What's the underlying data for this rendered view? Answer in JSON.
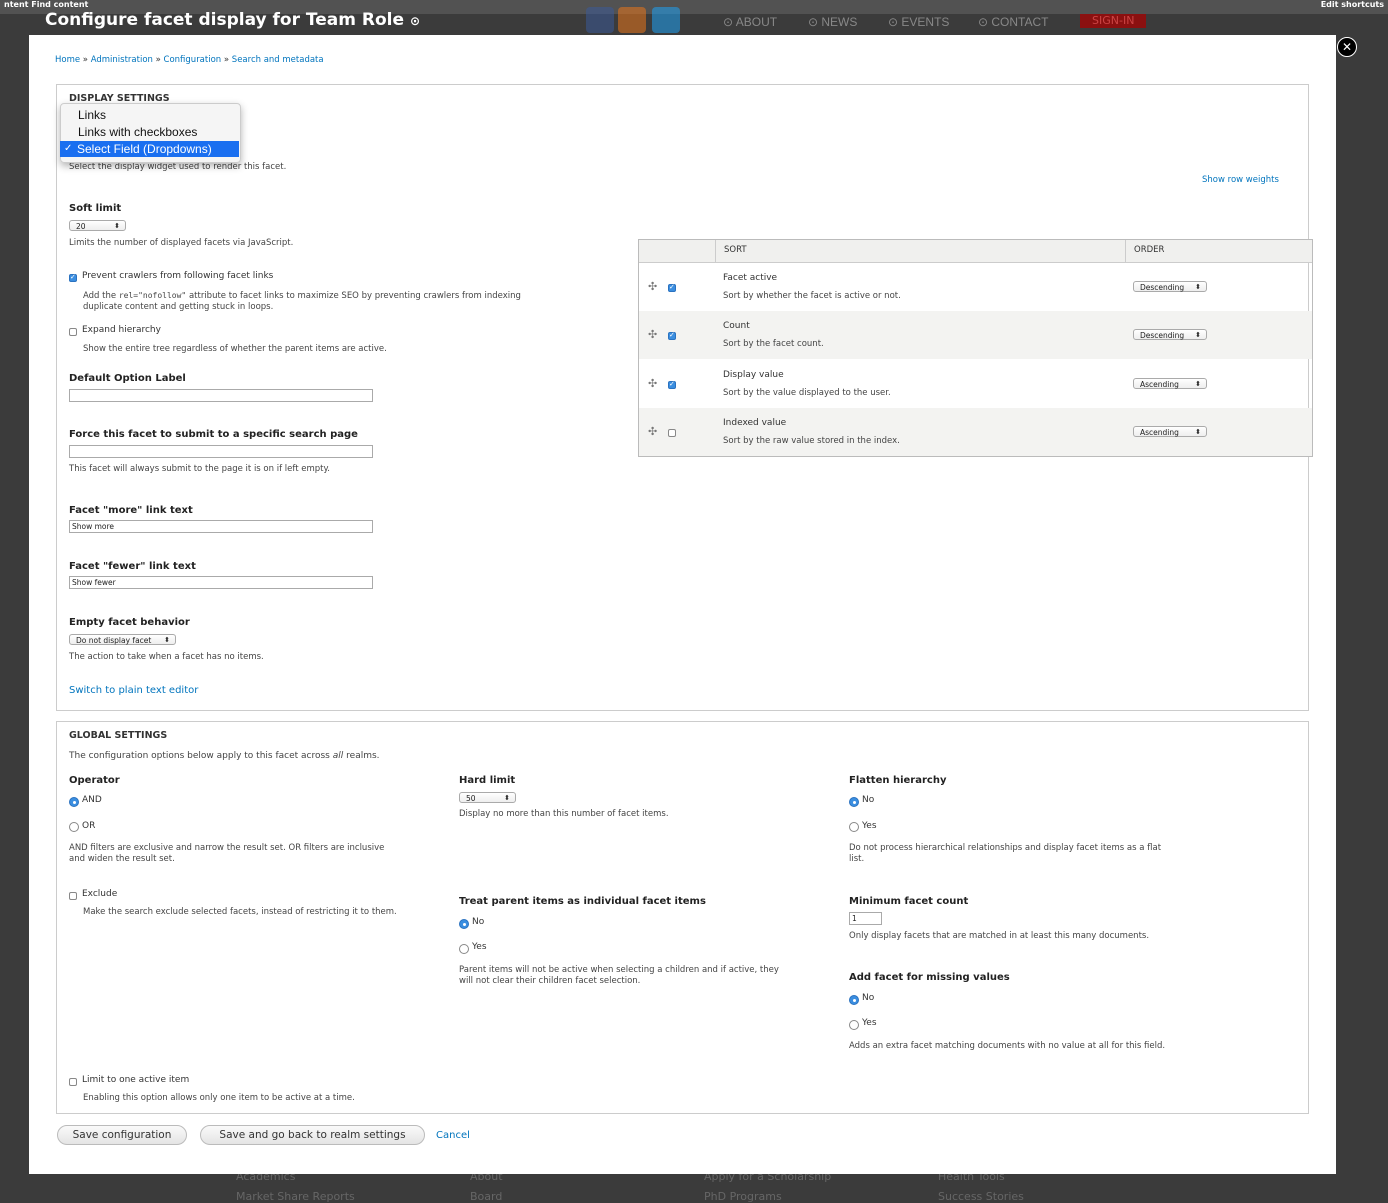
{
  "toolbar": {
    "left_links": "ntent  Find content",
    "right_link": "Edit shortcuts"
  },
  "site_nav": {
    "items": [
      "ABOUT",
      "NEWS",
      "EVENTS",
      "CONTACT"
    ],
    "sign_in": "SIGN-IN"
  },
  "overlay": {
    "title": "Configure facet display for Team Role"
  },
  "footer_links": [
    "Academics",
    "About",
    "Apply for a Scholarship",
    "Health Tools",
    "Market Share Reports",
    "Board",
    "PhD Programs",
    "Success Stories"
  ],
  "breadcrumb": [
    "Home",
    "Administration",
    "Configuration",
    "Search and metadata"
  ],
  "display_settings": {
    "legend": "DISPLAY SETTINGS",
    "widget_options": [
      "Links",
      "Links with checkboxes",
      "Select Field (Dropdowns)"
    ],
    "widget_selected": "Select Field (Dropdowns)",
    "widget_desc": "Select the display widget used to render this facet.",
    "soft_limit_label": "Soft limit",
    "soft_limit_value": "20",
    "soft_limit_desc": "Limits the number of displayed facets via JavaScript.",
    "nofollow_label": "Prevent crawlers from following facet links",
    "nofollow_desc_1": "Add the",
    "nofollow_code": "rel=\"nofollow\"",
    "nofollow_desc_2": "attribute to facet links to maximize SEO by preventing crawlers from indexing",
    "nofollow_desc_3": "duplicate content and getting stuck in loops.",
    "expand_label": "Expand hierarchy",
    "expand_desc": "Show the entire tree regardless of whether the parent items are active.",
    "default_option_label": "Default Option Label",
    "default_option_value": "",
    "force_label": "Force this facet to submit to a specific search page",
    "force_value": "",
    "force_desc": "This facet will always submit to the page it is on if left empty.",
    "more_label": "Facet \"more\" link text",
    "more_value": "Show more",
    "fewer_label": "Facet \"fewer\" link text",
    "fewer_value": "Show fewer",
    "empty_label": "Empty facet behavior",
    "empty_value": "Do not display facet",
    "empty_desc": "The action to take when a facet has no items.",
    "switch_editor": "Switch to plain text editor",
    "show_row_weights": "Show row weights",
    "sort_table": {
      "col_sort": "SORT",
      "col_order": "ORDER",
      "rows": [
        {
          "title": "Facet active",
          "desc": "Sort by whether the facet is active or not.",
          "order": "Descending",
          "checked": true
        },
        {
          "title": "Count",
          "desc": "Sort by the facet count.",
          "order": "Descending",
          "checked": true
        },
        {
          "title": "Display value",
          "desc": "Sort by the value displayed to the user.",
          "order": "Ascending",
          "checked": true
        },
        {
          "title": "Indexed value",
          "desc": "Sort by the raw value stored in the index.",
          "order": "Ascending",
          "checked": false
        }
      ]
    }
  },
  "global_settings": {
    "legend": "GLOBAL SETTINGS",
    "intro_1": "The configuration options below apply to this facet across",
    "intro_em": "all",
    "intro_2": "realms.",
    "operator_label": "Operator",
    "operator_and": "AND",
    "operator_or": "OR",
    "operator_desc_1": "AND filters are exclusive and narrow the result set. OR filters are inclusive",
    "operator_desc_2": "and widen the result set.",
    "exclude_label": "Exclude",
    "exclude_desc": "Make the search exclude selected facets, instead of restricting it to them.",
    "hard_limit_label": "Hard limit",
    "hard_limit_value": "50",
    "hard_limit_desc": "Display no more than this number of facet items.",
    "treat_parent_label": "Treat parent items as individual facet items",
    "no": "No",
    "yes": "Yes",
    "treat_parent_desc_1": "Parent items will not be active when selecting a children and if active, they",
    "treat_parent_desc_2": "will not clear their children facet selection.",
    "flatten_label": "Flatten hierarchy",
    "flatten_desc_1": "Do not process hierarchical relationships and display facet items as a flat",
    "flatten_desc_2": "list.",
    "min_count_label": "Minimum facet count",
    "min_count_value": "1",
    "min_count_desc": "Only display facets that are matched in at least this many documents.",
    "missing_label": "Add facet for missing values",
    "missing_desc": "Adds an extra facet matching documents with no value at all for this field.",
    "limit_one_label": "Limit to one active item",
    "limit_one_desc": "Enabling this option allows only one item to be active at a time."
  },
  "actions": {
    "save": "Save configuration",
    "save_back": "Save and go back to realm settings",
    "cancel": "Cancel"
  },
  "colors": {
    "link": "#0074bd",
    "selected": "#1a6ff0",
    "checkbox": "#3b8ee0"
  }
}
